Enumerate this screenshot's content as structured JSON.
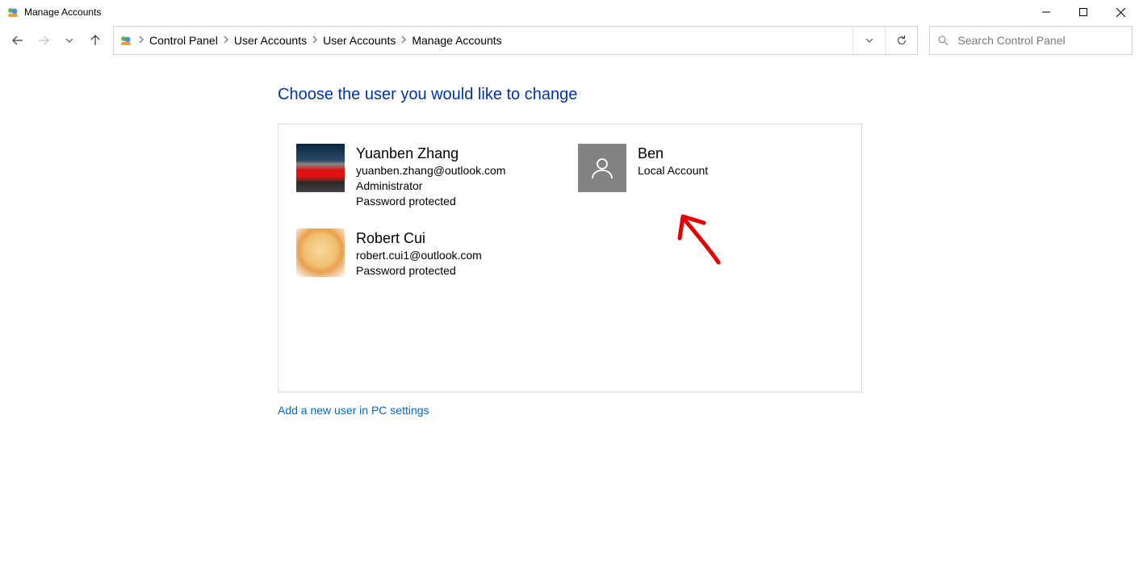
{
  "window": {
    "title": "Manage Accounts"
  },
  "breadcrumb": {
    "items": [
      "Control Panel",
      "User Accounts",
      "User Accounts",
      "Manage Accounts"
    ]
  },
  "search": {
    "placeholder": "Search Control Panel"
  },
  "page": {
    "heading": "Choose the user you would like to change",
    "addUserLink": "Add a new user in PC settings"
  },
  "accounts": [
    {
      "name": "Yuanben Zhang",
      "email": "yuanben.zhang@outlook.com",
      "role": "Administrator",
      "status": "Password protected",
      "avatar": "car"
    },
    {
      "name": "Ben",
      "role": "Local Account",
      "avatar": "gray"
    },
    {
      "name": "Robert Cui",
      "email": "robert.cui1@outlook.com",
      "status": "Password protected",
      "avatar": "cat"
    }
  ]
}
